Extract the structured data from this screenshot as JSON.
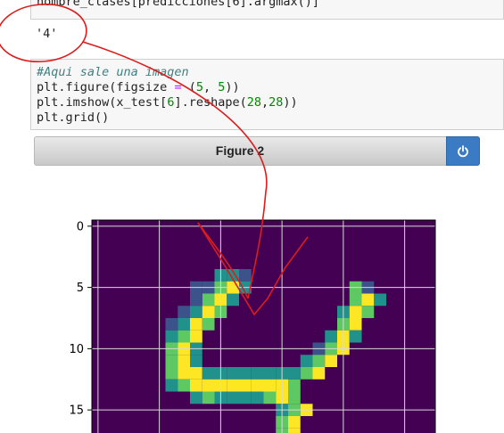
{
  "top_code": {
    "text": "nombre_clases[predicciones[6].argmax()]"
  },
  "output": {
    "text": "'4'"
  },
  "code_cell": {
    "comment": "#Aqui sale una imagen",
    "line2_a": "plt.figure(figsize ",
    "line2_op": "=",
    "line2_b": " (",
    "line2_n1": "5",
    "line2_c": ", ",
    "line2_n2": "5",
    "line2_d": "))",
    "line3_a": "plt.imshow(x_test[",
    "line3_n1": "6",
    "line3_b": "].reshape(",
    "line3_n2": "28",
    "line3_c": ",",
    "line3_n3": "28",
    "line3_d": "))",
    "line4": "plt.grid()"
  },
  "figure": {
    "title": "Figure 2",
    "power_button_icon": "power-icon",
    "y_tick_labels": [
      "0",
      "5",
      "10",
      "15"
    ],
    "image_colormap": "viridis",
    "background_color": "#440154",
    "grid": true
  },
  "colors": {
    "annotation_red": "#dd1c1c",
    "button_blue": "#3a7bc4"
  }
}
